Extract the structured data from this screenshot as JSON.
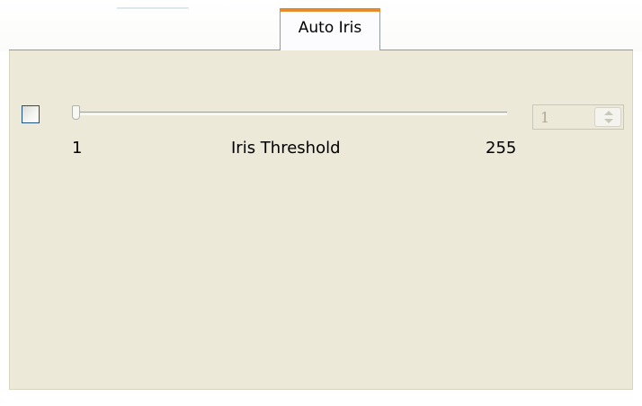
{
  "tabs": [
    {
      "label": "Auto Iris",
      "selected": true
    }
  ],
  "auto_iris": {
    "enable_checkbox": {
      "checked": false
    },
    "slider": {
      "label": "Iris Threshold",
      "min_label": "1",
      "max_label": "255",
      "min": 1,
      "max": 255,
      "value": 1,
      "enabled": false
    },
    "spinbox": {
      "value": "1",
      "enabled": false,
      "icons": [
        "spin-up-icon",
        "spin-down-icon"
      ]
    }
  },
  "colors": {
    "panel_background": "#ece9d8",
    "tab_accent": "#e68b2c",
    "disabled_text": "#aca899"
  }
}
